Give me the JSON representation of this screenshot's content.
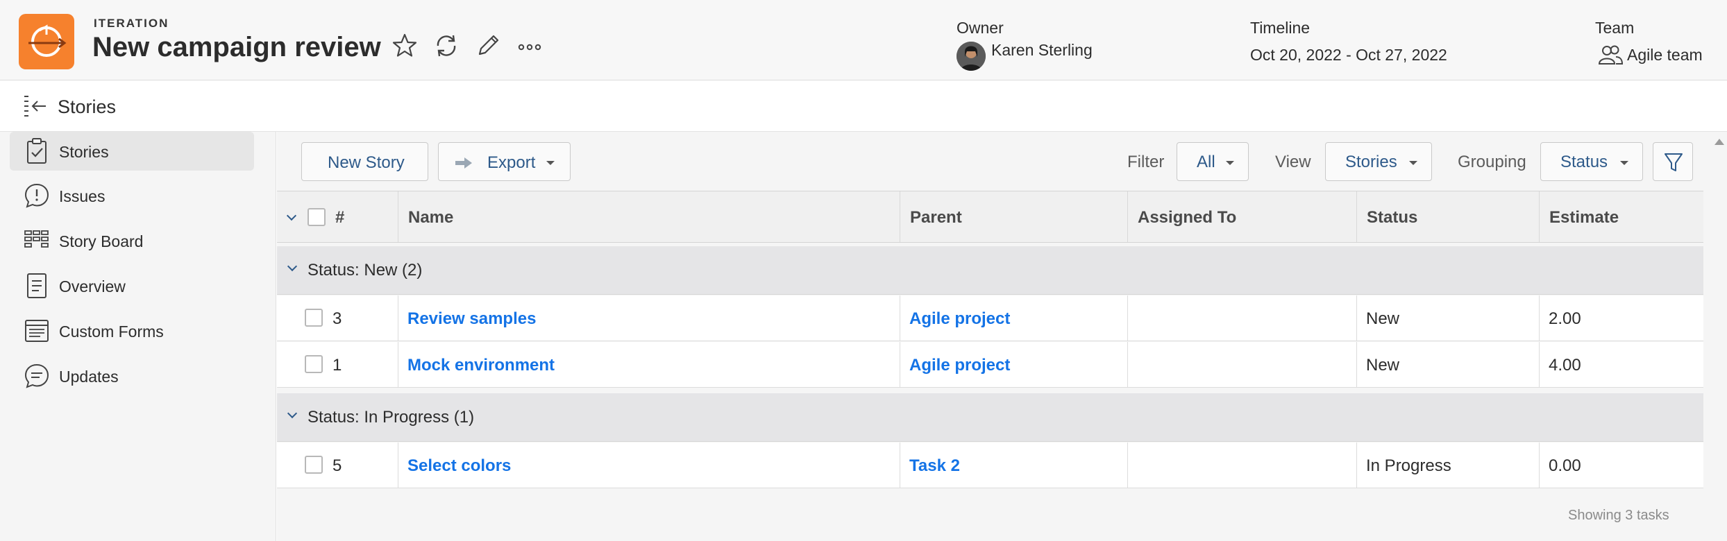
{
  "header": {
    "object_type": "ITERATION",
    "title": "New campaign review",
    "owner_label": "Owner",
    "owner_name": "Karen Sterling",
    "timeline_label": "Timeline",
    "timeline_value": "Oct 20, 2022 - Oct 27, 2022",
    "team_label": "Team",
    "team_value": "Agile team",
    "logo_color": "#f6812d",
    "icons": [
      "star-icon",
      "refresh-icon",
      "pencil-icon",
      "more-icon"
    ]
  },
  "subheader": {
    "title": "Stories"
  },
  "sidebar": {
    "items": [
      {
        "label": "Stories",
        "icon": "clipboard-check-icon",
        "active": true
      },
      {
        "label": "Issues",
        "icon": "exclamation-bubble-icon",
        "active": false
      },
      {
        "label": "Story Board",
        "icon": "board-icon",
        "active": false
      },
      {
        "label": "Overview",
        "icon": "document-icon",
        "active": false
      },
      {
        "label": "Custom Forms",
        "icon": "form-icon",
        "active": false
      },
      {
        "label": "Updates",
        "icon": "chat-bubble-icon",
        "active": false
      }
    ]
  },
  "toolbar": {
    "new_story": "New Story",
    "export": "Export",
    "filter_label": "Filter",
    "filter_value": "All",
    "view_label": "View",
    "view_value": "Stories",
    "grouping_label": "Grouping",
    "grouping_value": "Status"
  },
  "table": {
    "columns": [
      "#",
      "Name",
      "Parent",
      "Assigned To",
      "Status",
      "Estimate"
    ],
    "groups": [
      {
        "label": "Status: New (2)",
        "rows": [
          {
            "num": "3",
            "name": "Review samples",
            "parent": "Agile project",
            "assigned": "",
            "status": "New",
            "estimate": "2.00"
          },
          {
            "num": "1",
            "name": "Mock environment",
            "parent": "Agile project",
            "assigned": "",
            "status": "New",
            "estimate": "4.00"
          }
        ]
      },
      {
        "label": "Status: In Progress (1)",
        "rows": [
          {
            "num": "5",
            "name": "Select colors",
            "parent": "Task 2",
            "assigned": "",
            "status": "In Progress",
            "estimate": "0.00"
          }
        ]
      }
    ],
    "footer": "Showing 3 tasks"
  },
  "colors": {
    "link": "#1473e6",
    "accent": "#2e5a8a"
  }
}
